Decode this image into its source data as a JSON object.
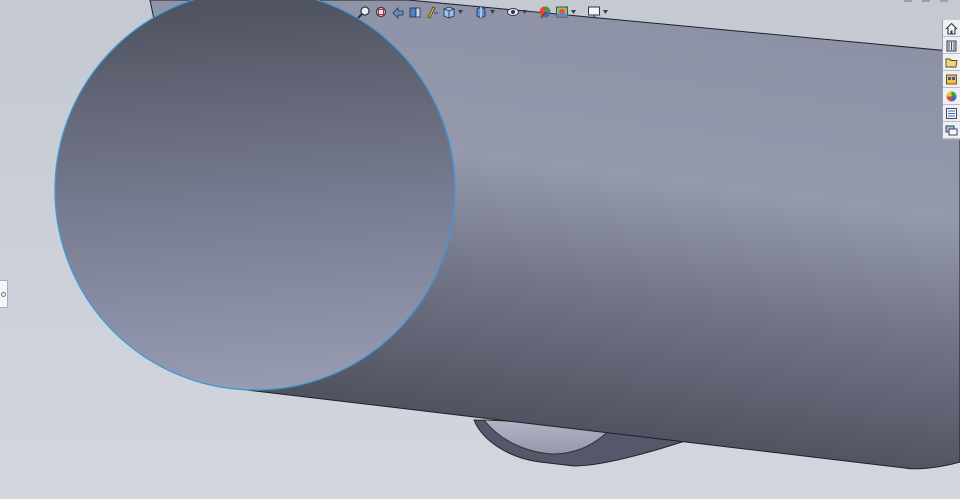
{
  "colors": {
    "background": "#cdd1da",
    "face_top": "#525663",
    "face_bottom": "#9599b0",
    "body_light": "#9397aa",
    "body_dark": "#4c4f5c",
    "edge_highlight": "#3d98d6",
    "cut_inner": "#a0a4ba"
  },
  "hud_toolbar": {
    "icons": [
      "zoom-to-fit-icon",
      "zoom-to-area-icon",
      "previous-view-icon",
      "section-view-icon",
      "dynamic-annotation-icon",
      "view-orientation-icon",
      "display-style-icon",
      "hide-show-items-icon",
      "edit-appearance-icon",
      "apply-scene-icon",
      "view-settings-icon"
    ]
  },
  "task_pane": {
    "tabs": [
      "home-icon",
      "design-library-icon",
      "file-explorer-icon",
      "view-palette-icon",
      "appearances-icon",
      "custom-properties-icon",
      "forum-icon"
    ]
  }
}
